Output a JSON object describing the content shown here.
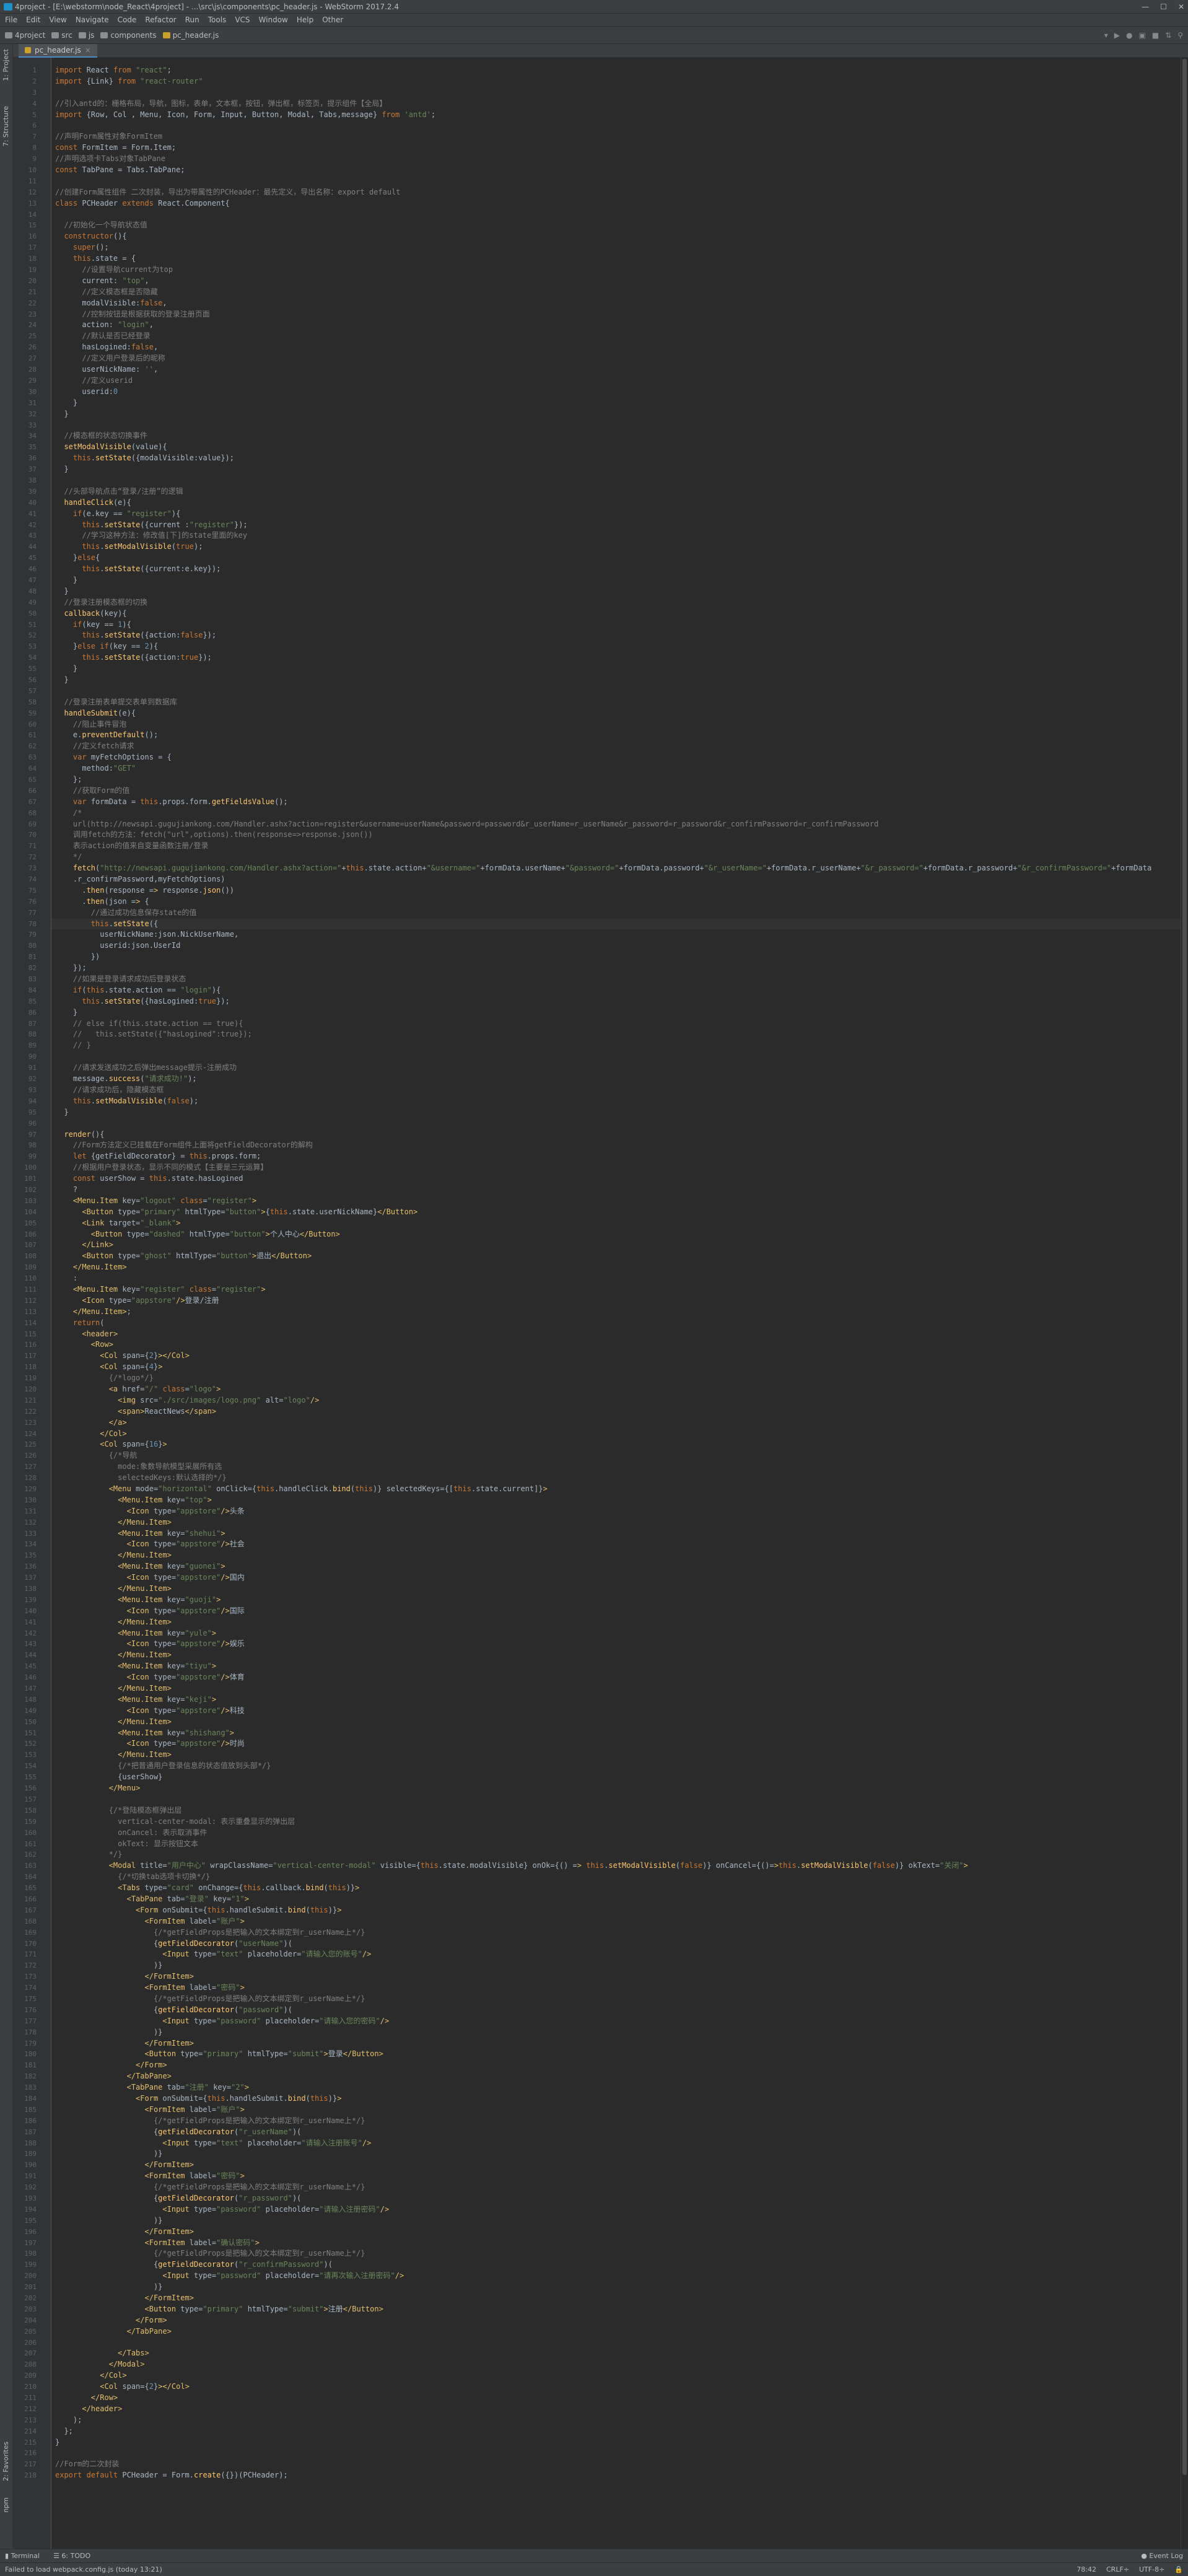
{
  "window": {
    "title": "4project - [E:\\webstorm\\node_React\\4project] - ...\\src\\js\\components\\pc_header.js - WebStorm 2017.2.4"
  },
  "menu": [
    "File",
    "Edit",
    "View",
    "Navigate",
    "Code",
    "Refactor",
    "Run",
    "Tools",
    "VCS",
    "Window",
    "Help",
    "Other"
  ],
  "breadcrumb": [
    "4project",
    "src",
    "js",
    "components",
    "pc_header.js"
  ],
  "editor_tab": "pc_header.js",
  "sidebar": {
    "project": "1: Project",
    "structure": "7: Structure",
    "favorites": "2: Favorites",
    "npm": "npm"
  },
  "toolwindows": {
    "terminal": "Terminal",
    "todo": "6: TODO",
    "event_log": "Event Log"
  },
  "status": {
    "message": "Failed to load webpack.config.js (today 13:21)",
    "position": "78:42",
    "line_sep": "CRLF÷",
    "encoding": "UTF-8÷"
  },
  "current_line": 78,
  "lines": [
    "import React from \"react\";",
    "import {Link} from \"react-router\"",
    "",
    "//引入antd的：栅格布局，导航，图标，表单，文本框，按钮，弹出框，标签页，提示组件【全局】",
    "import {Row, Col , Menu, Icon, Form, Input, Button, Modal, Tabs,message} from 'antd';",
    "",
    "//声明Form属性对象FormItem",
    "const FormItem = Form.Item;",
    "//声明选项卡Tabs对象TabPane",
    "const TabPane = Tabs.TabPane;",
    "",
    "//创建Form属性组件 二次封装，导出为带属性的PCHeader：最先定义，导出名称：export default",
    "class PCHeader extends React.Component{",
    "",
    "  //初始化一个导航状态值",
    "  constructor(){",
    "    super();",
    "    this.state = {",
    "      //设置导航current为top",
    "      current: \"top\",",
    "      //定义模态框是否隐藏",
    "      modalVisible:false,",
    "      //控制按钮是根据获取的登录注册页面",
    "      action: \"login\",",
    "      //默认是否已经登录",
    "      hasLogined:false,",
    "      //定义用户登录后的昵称",
    "      userNickName: '',",
    "      //定义userid",
    "      userid:0",
    "    }",
    "  }",
    "",
    "  //模态框的状态切换事件",
    "  setModalVisible(value){",
    "    this.setState({modalVisible:value});",
    "  }",
    "",
    "  //头部导航点击“登录/注册”的逻辑",
    "  handleClick(e){",
    "    if(e.key == \"register\"){",
    "      this.setState({current :\"register\"});",
    "      //学习这种方法：修改值[下]的state里面的key",
    "      this.setModalVisible(true);",
    "    }else{",
    "      this.setState({current:e.key});",
    "    }",
    "  }",
    "  //登录注册模态框的切换",
    "  callback(key){",
    "    if(key == 1){",
    "      this.setState({action:false});",
    "    }else if(key == 2){",
    "      this.setState({action:true});",
    "    }",
    "  }",
    "",
    "  //登录注册表单提交表单到数据库",
    "  handleSubmit(e){",
    "    //阻止事件冒泡",
    "    e.preventDefault();",
    "    //定义fetch请求",
    "    var myFetchOptions = {",
    "      method:\"GET\"",
    "    };",
    "    //获取Form的值",
    "    var formData = this.props.form.getFieldsValue();",
    "    /*",
    "    url(http://newsapi.gugujiankong.com/Handler.ashx?action=register&username=userName&password=password&r_userName=r_userName&r_password=r_password&r_confirmPassword=r_confirmPassword",
    "    调用fetch的方法：fetch(\"url\",options).then(response=>response.json())",
    "    表示action的值来自变量函数注册/登录",
    "    */",
    "    fetch(\"http://newsapi.gugujiankong.com/Handler.ashx?action=\"+this.state.action+\"&username=\"+formData.userName+\"&password=\"+formData.password+\"&r_userName=\"+formData.r_userName+\"&r_password=\"+formData.r_password+\"&r_confirmPassword=\"+formData",
    "    .r_confirmPassword,myFetchOptions)",
    "      .then(response => response.json())",
    "      .then(json => {",
    "        //通过成功信息保存state的值",
    "        this.setState({",
    "          userNickName:json.NickUserName,",
    "          userid:json.UserId",
    "        })",
    "    });",
    "    //如果是登录请求成功后登录状态",
    "    if(this.state.action == \"login\"){",
    "      this.setState({hasLogined:true});",
    "    }",
    "    // else if(this.state.action == true){",
    "    //   this.setState({\"hasLogined\":true});",
    "    // }",
    "",
    "    //请求发送成功之后弹出message提示-注册成功",
    "    message.success(\"请求成功!\");",
    "    //请求成功后，隐藏模态框",
    "    this.setModalVisible(false);",
    "  }",
    "",
    "  render(){",
    "    //Form方法定义已挂载在Form组件上面将getFieldDecorator的解构",
    "    let {getFieldDecorator} = this.props.form;",
    "    //根据用户登录状态，显示不同的模式【主要是三元运算】",
    "    const userShow = this.state.hasLogined",
    "    ?",
    "    <Menu.Item key=\"logout\" class=\"register\">",
    "      <Button type=\"primary\" htmlType=\"button\">{this.state.userNickName}</Button>",
    "      <Link target=\"_blank\">",
    "        <Button type=\"dashed\" htmlType=\"button\">个人中心</Button>",
    "      </Link>",
    "      <Button type=\"ghost\" htmlType=\"button\">退出</Button>",
    "    </Menu.Item>",
    "    :",
    "    <Menu.Item key=\"register\" class=\"register\">",
    "      <Icon type=\"appstore\"/>登录/注册",
    "    </Menu.Item>;",
    "    return(",
    "      <header>",
    "        <Row>",
    "          <Col span={2}></Col>",
    "          <Col span={4}>",
    "            {/*logo*/}",
    "            <a href=\"/\" class=\"logo\">",
    "              <img src=\"./src/images/logo.png\" alt=\"logo\"/>",
    "              <span>ReactNews</span>",
    "            </a>",
    "          </Col>",
    "          <Col span={16}>",
    "            {/*导航",
    "              mode:象数导航模型采展所有选",
    "              selectedKeys:默认选择的*/}",
    "            <Menu mode=\"horizontal\" onClick={this.handleClick.bind(this)} selectedKeys={[this.state.current]}>",
    "              <Menu.Item key=\"top\">",
    "                <Icon type=\"appstore\"/>头条",
    "              </Menu.Item>",
    "              <Menu.Item key=\"shehui\">",
    "                <Icon type=\"appstore\"/>社会",
    "              </Menu.Item>",
    "              <Menu.Item key=\"guonei\">",
    "                <Icon type=\"appstore\"/>国内",
    "              </Menu.Item>",
    "              <Menu.Item key=\"guoji\">",
    "                <Icon type=\"appstore\"/>国际",
    "              </Menu.Item>",
    "              <Menu.Item key=\"yule\">",
    "                <Icon type=\"appstore\"/>娱乐",
    "              </Menu.Item>",
    "              <Menu.Item key=\"tiyu\">",
    "                <Icon type=\"appstore\"/>体育",
    "              </Menu.Item>",
    "              <Menu.Item key=\"keji\">",
    "                <Icon type=\"appstore\"/>科技",
    "              </Menu.Item>",
    "              <Menu.Item key=\"shishang\">",
    "                <Icon type=\"appstore\"/>时尚",
    "              </Menu.Item>",
    "              {/*把普通用户登录信息的状态值放到头部*/}",
    "              {userShow}",
    "            </Menu>",
    "",
    "            {/*登陆模态框弹出层",
    "              vertical-center-modal: 表示重叠显示的弹出层",
    "              onCancel: 表示取消事件",
    "              okText: 显示按钮文本",
    "            */}",
    "            <Modal title=\"用户中心\" wrapClassName=\"vertical-center-modal\" visible={this.state.modalVisible} onOk={() => this.setModalVisible(false)} onCancel={()=>this.setModalVisible(false)} okText=\"关闭\">",
    "              {/*切换tab选项卡切换*/}",
    "              <Tabs type=\"card\" onChange={this.callback.bind(this)}>",
    "                <TabPane tab=\"登录\" key=\"1\">",
    "                  <Form onSubmit={this.handleSubmit.bind(this)}>",
    "                    <FormItem label=\"账户\">",
    "                      {/*getFieldProps是把输入的文本绑定到r_userName上*/}",
    "                      {getFieldDecorator(\"userName\")(",
    "                        <Input type=\"text\" placeholder=\"请输入您的账号\"/>",
    "                      )}",
    "                    </FormItem>",
    "                    <FormItem label=\"密码\">",
    "                      {/*getFieldProps是把输入的文本绑定到r_userName上*/}",
    "                      {getFieldDecorator(\"password\")(",
    "                        <Input type=\"password\" placeholder=\"请输入您的密码\"/>",
    "                      )}",
    "                    </FormItem>",
    "                    <Button type=\"primary\" htmlType=\"submit\">登录</Button>",
    "                  </Form>",
    "                </TabPane>",
    "                <TabPane tab=\"注册\" key=\"2\">",
    "                  <Form onSubmit={this.handleSubmit.bind(this)}>",
    "                    <FormItem label=\"账户\">",
    "                      {/*getFieldProps是把输入的文本绑定到r_userName上*/}",
    "                      {getFieldDecorator(\"r_userName\")(",
    "                        <Input type=\"text\" placeholder=\"请输入注册账号\"/>",
    "                      )}",
    "                    </FormItem>",
    "                    <FormItem label=\"密码\">",
    "                      {/*getFieldProps是把输入的文本绑定到r_userName上*/}",
    "                      {getFieldDecorator(\"r_password\")(",
    "                        <Input type=\"password\" placeholder=\"请输入注册密码\"/>",
    "                      )}",
    "                    </FormItem>",
    "                    <FormItem label=\"确认密码\">",
    "                      {/*getFieldProps是把输入的文本绑定到r_userName上*/}",
    "                      {getFieldDecorator(\"r_confirmPassword\")(",
    "                        <Input type=\"password\" placeholder=\"请再次输入注册密码\"/>",
    "                      )}",
    "                    </FormItem>",
    "                    <Button type=\"primary\" htmlType=\"submit\">注册</Button>",
    "                  </Form>",
    "                </TabPane>",
    "",
    "              </Tabs>",
    "            </Modal>",
    "          </Col>",
    "          <Col span={2}></Col>",
    "        </Row>",
    "      </header>",
    "    );",
    "  };",
    "}",
    "",
    "//Form的二次封装",
    "export default PCHeader = Form.create({})(PCHeader);"
  ]
}
